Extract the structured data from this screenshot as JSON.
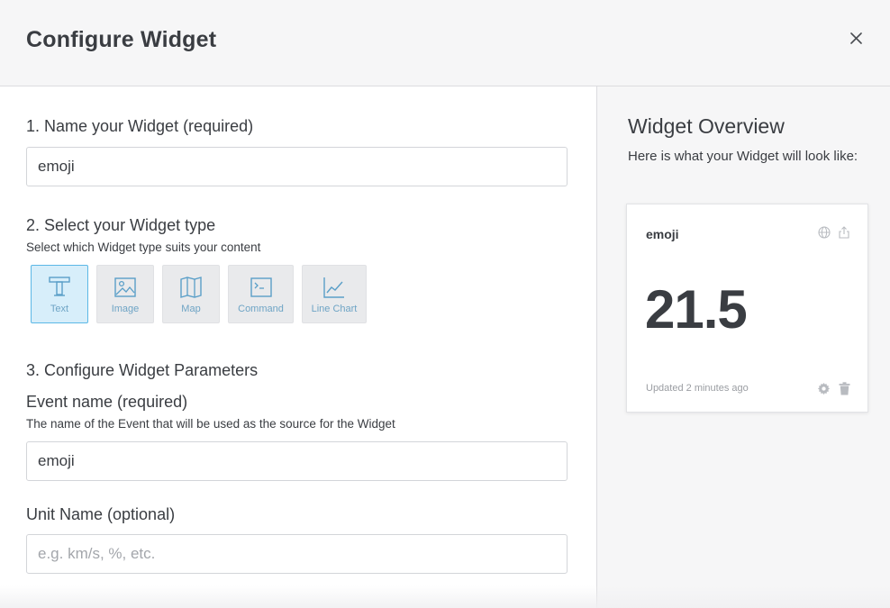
{
  "header": {
    "title": "Configure Widget",
    "close_icon": "close-icon"
  },
  "form": {
    "step1": {
      "heading": "1. Name your Widget (required)",
      "value": "emoji"
    },
    "step2": {
      "heading": "2. Select your Widget type",
      "help": "Select which Widget type suits your content",
      "types": [
        {
          "label": "Text",
          "icon": "text-icon",
          "selected": true
        },
        {
          "label": "Image",
          "icon": "image-icon",
          "selected": false
        },
        {
          "label": "Map",
          "icon": "map-icon",
          "selected": false
        },
        {
          "label": "Command",
          "icon": "terminal-icon",
          "selected": false
        },
        {
          "label": "Line Chart",
          "icon": "line-chart-icon",
          "selected": false
        }
      ]
    },
    "step3": {
      "heading": "3. Configure Widget Parameters",
      "event_label": "Event name (required)",
      "event_help": "The name of the Event that will be used as the source for the Widget",
      "event_value": "emoji",
      "unit_label": "Unit Name (optional)",
      "unit_placeholder": "e.g. km/s, %, etc.",
      "unit_value": ""
    }
  },
  "overview": {
    "title": "Widget Overview",
    "subtitle": "Here is what your Widget will look like:",
    "card": {
      "title": "emoji",
      "value": "21.5",
      "updated": "Updated 2 minutes ago",
      "icons": [
        "globe-icon",
        "share-icon",
        "gear-icon",
        "trash-icon"
      ]
    }
  },
  "colors": {
    "accent": "#5bb8e6",
    "selected_bg": "#d7eefa",
    "text": "#3a3d42",
    "muted": "#9a9da2"
  }
}
